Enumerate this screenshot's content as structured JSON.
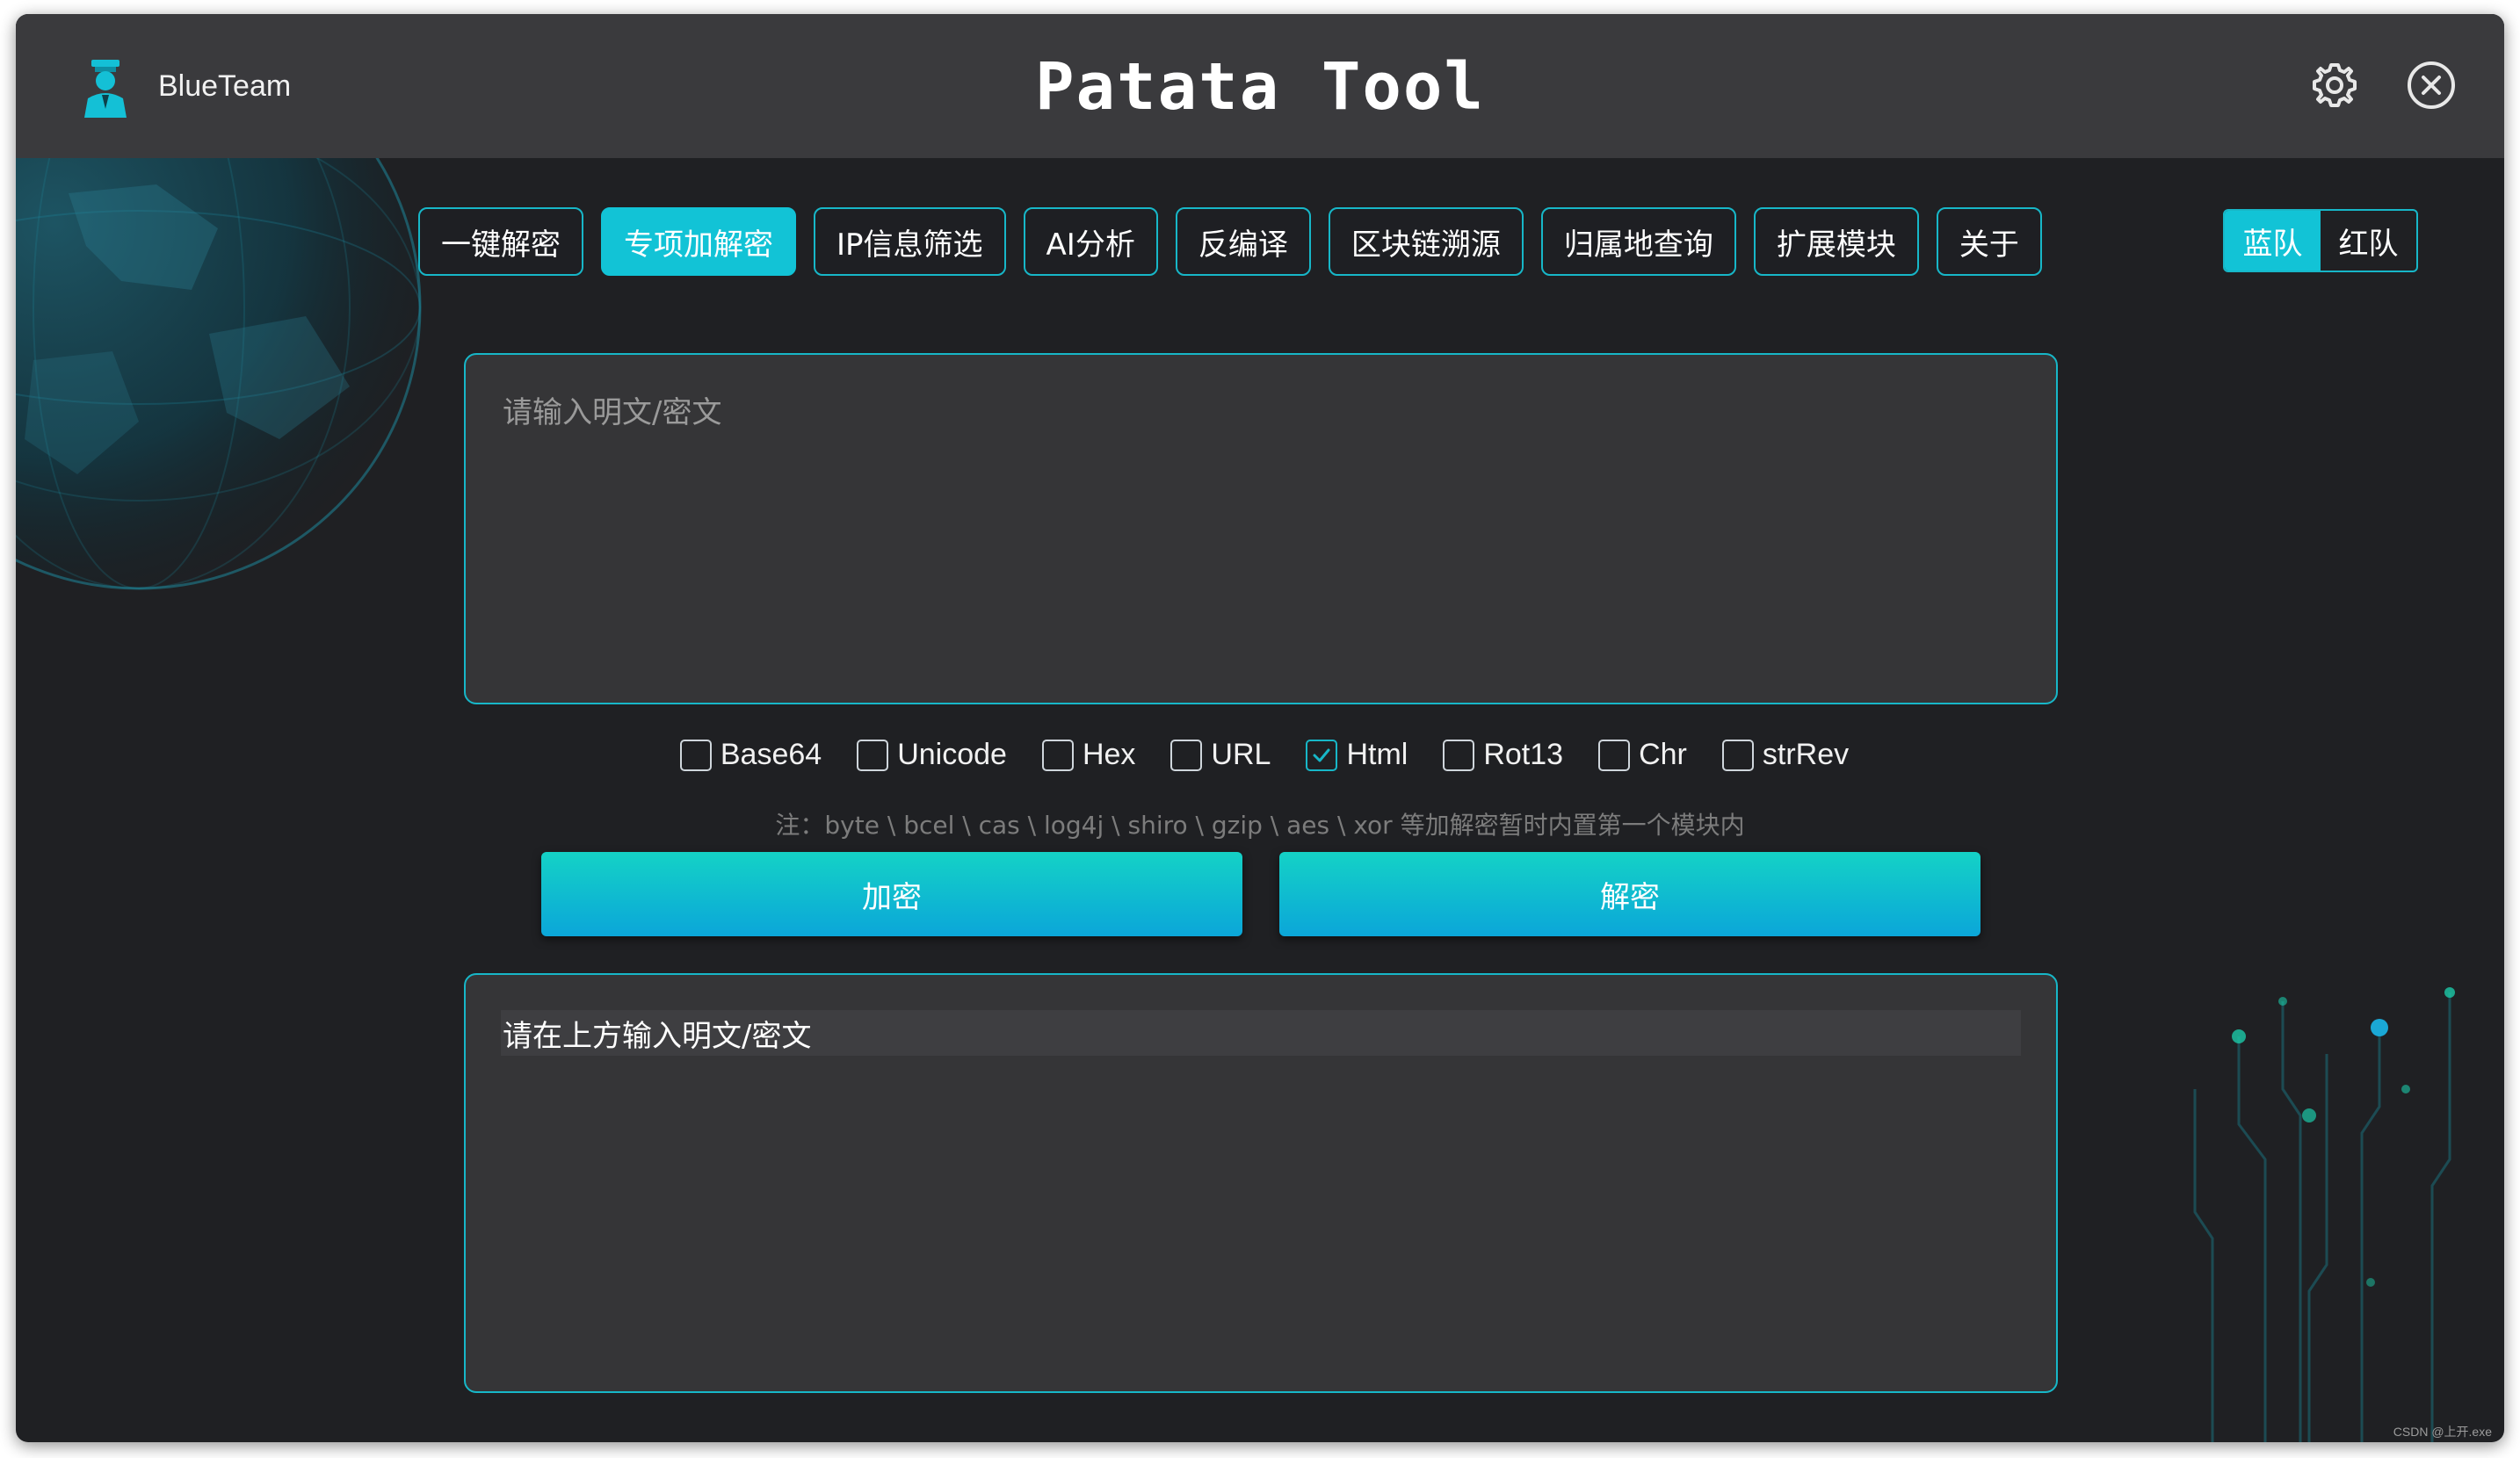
{
  "app": {
    "brand_name": "BlueTeam",
    "title": "Patata Tool"
  },
  "titlebar_icons": [
    "gear-icon",
    "close-circle-icon"
  ],
  "nav": {
    "tabs": [
      {
        "label": "一键解密",
        "active": false
      },
      {
        "label": "专项加解密",
        "active": true
      },
      {
        "label": "IP信息筛选",
        "active": false
      },
      {
        "label": "AI分析",
        "active": false
      },
      {
        "label": "反编译",
        "active": false
      },
      {
        "label": "区块链溯源",
        "active": false
      },
      {
        "label": "归属地查询",
        "active": false
      },
      {
        "label": "扩展模块",
        "active": false
      },
      {
        "label": "关于",
        "active": false
      }
    ]
  },
  "team_toggle": {
    "blue": "蓝队",
    "red": "红队",
    "selected": "蓝队"
  },
  "input": {
    "placeholder": "请输入明文/密文",
    "value": ""
  },
  "options": [
    {
      "label": "Base64",
      "checked": false
    },
    {
      "label": "Unicode",
      "checked": false
    },
    {
      "label": "Hex",
      "checked": false
    },
    {
      "label": "URL",
      "checked": false
    },
    {
      "label": "Html",
      "checked": true
    },
    {
      "label": "Rot13",
      "checked": false
    },
    {
      "label": "Chr",
      "checked": false
    },
    {
      "label": "strRev",
      "checked": false
    }
  ],
  "note": "注：byte \\ bcel \\ cas \\ log4j \\ shiro \\ gzip \\ aes \\ xor 等加解密暂时内置第一个模块内",
  "buttons": {
    "encrypt": "加密",
    "decrypt": "解密"
  },
  "output": {
    "text": "请在上方输入明文/密文"
  },
  "colors": {
    "accent": "#12c3d6",
    "background": "#1f2023",
    "titlebar": "#3a3a3d",
    "panel": "#353537"
  },
  "watermark": "CSDN @上开.exe"
}
